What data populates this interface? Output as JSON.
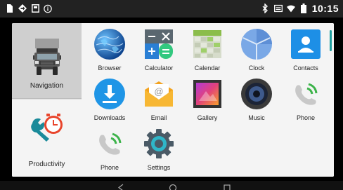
{
  "status_bar": {
    "time": "10:15",
    "left_icons": [
      "sim-icon",
      "navigation-arrow-icon",
      "sd-card-icon",
      "info-icon"
    ],
    "right_icons": [
      "bluetooth-icon",
      "cast-icon",
      "wifi-icon",
      "battery-icon"
    ]
  },
  "categories": [
    {
      "label": "Navigation",
      "icon": "truck-icon",
      "selected": true
    },
    {
      "label": "Productivity",
      "icon": "wrench-clock-icon",
      "selected": false
    }
  ],
  "apps": [
    {
      "label": "Browser",
      "icon": "globe-icon"
    },
    {
      "label": "Calculator",
      "icon": "calculator-icon"
    },
    {
      "label": "Calendar",
      "icon": "calendar-icon"
    },
    {
      "label": "Clock",
      "icon": "clock-icon"
    },
    {
      "label": "Contacts",
      "icon": "contacts-icon"
    },
    {
      "label": "Downloads",
      "icon": "download-icon"
    },
    {
      "label": "Email",
      "icon": "email-icon"
    },
    {
      "label": "Gallery",
      "icon": "gallery-icon"
    },
    {
      "label": "Music",
      "icon": "speaker-icon"
    },
    {
      "label": "Phone",
      "icon": "phone-icon"
    },
    {
      "label": "Phone",
      "icon": "phone-icon"
    },
    {
      "label": "Settings",
      "icon": "gear-icon"
    }
  ],
  "nav_bar": [
    "back-icon",
    "home-icon",
    "recents-icon"
  ]
}
